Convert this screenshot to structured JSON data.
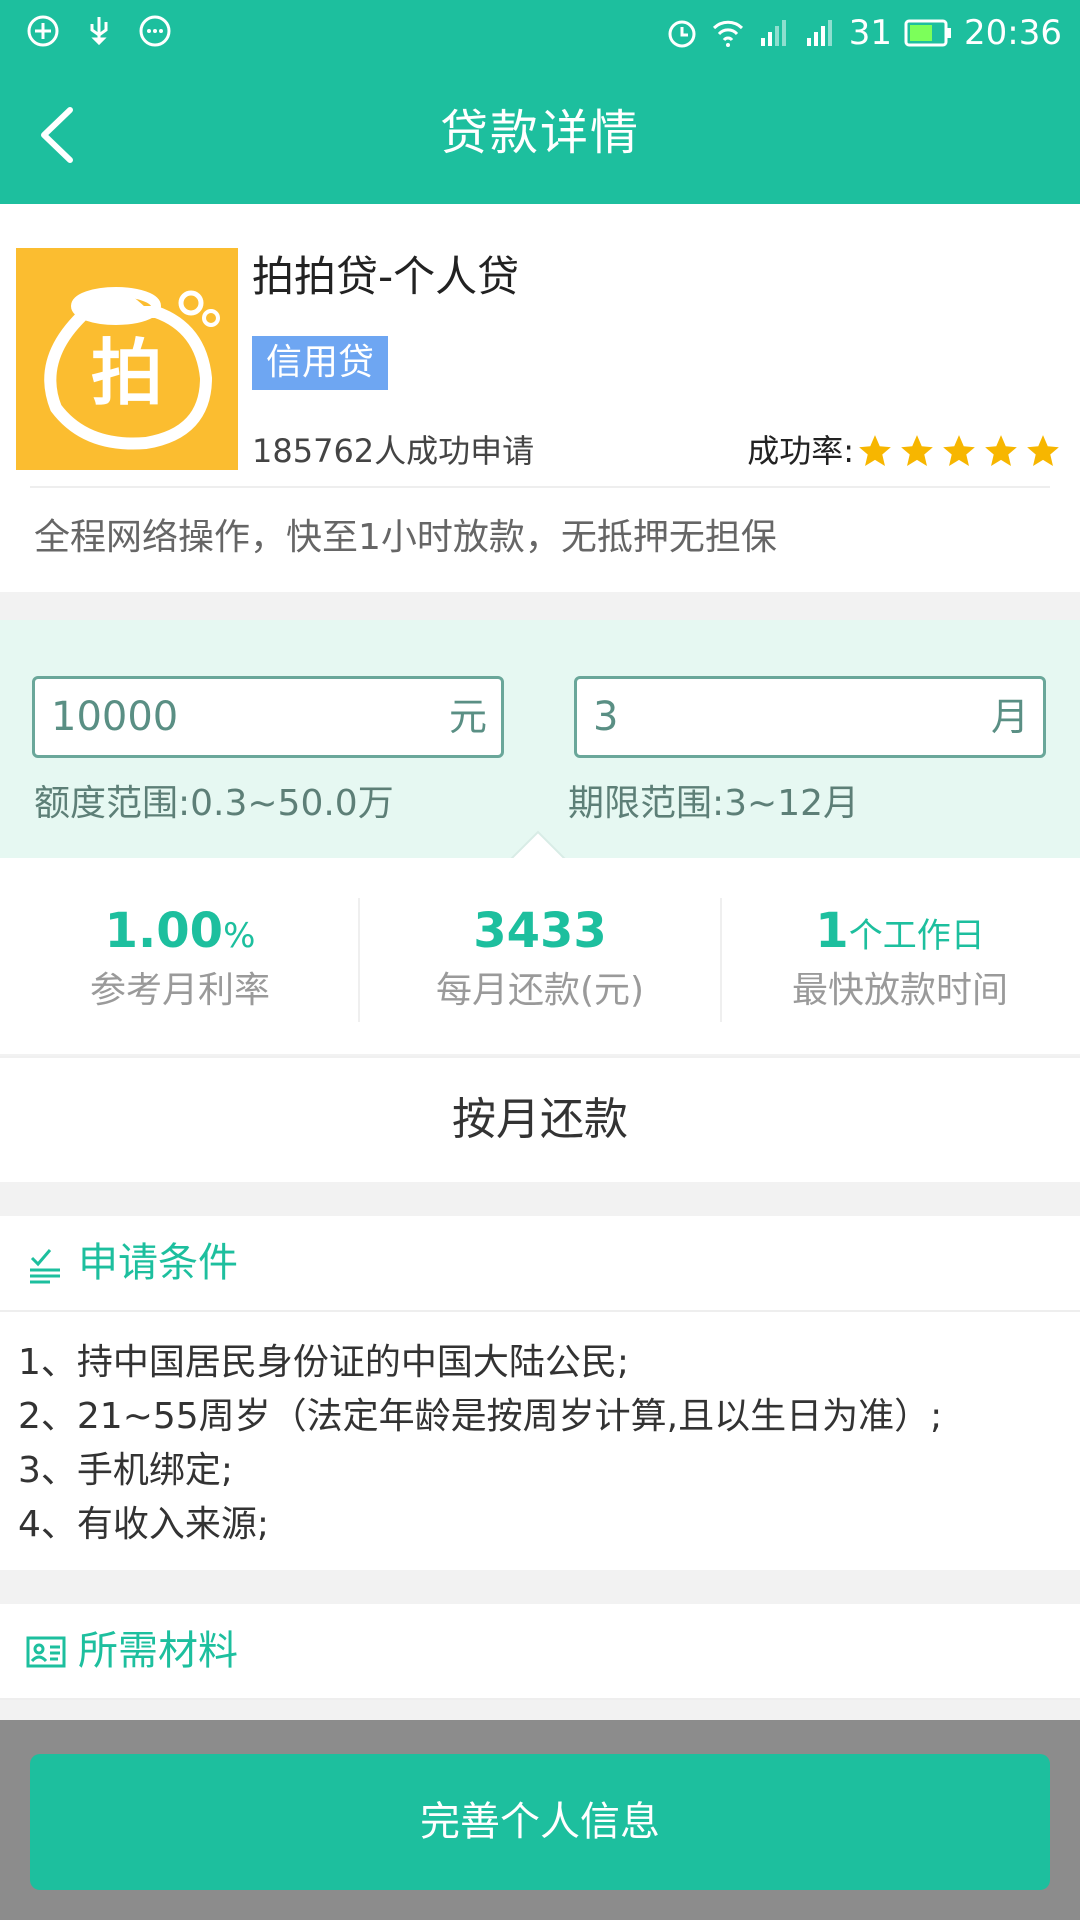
{
  "status_bar": {
    "signal_text": "31",
    "time": "20:36",
    "icons": [
      "vpn-icon",
      "usb-icon",
      "chat-icon",
      "alarm-icon",
      "wifi-icon",
      "signal-icon",
      "signal-icon-2",
      "battery-icon"
    ]
  },
  "toolbar": {
    "title": "贷款详情",
    "back_icon": "back-arrow-icon"
  },
  "product": {
    "name": "拍拍贷-个人贷",
    "tag": "信用贷",
    "apply_count": "185762人成功申请",
    "success_label": "成功率:",
    "success_stars": 5,
    "description": "全程网络操作，快至1小时放款，无抵押无担保",
    "logo_char": "拍"
  },
  "calculator": {
    "amount_value": "10000",
    "amount_unit": "元",
    "amount_range": "额度范围:0.3~50.0万",
    "term_value": "3",
    "term_unit": "月",
    "term_range": "期限范围:3~12月"
  },
  "stats": [
    {
      "value": "1.00",
      "unit": "%",
      "label": "参考月利率"
    },
    {
      "value": "3433",
      "unit": "",
      "label": "每月还款(元)"
    },
    {
      "value": "1",
      "unit": "个工作日",
      "label": "最快放款时间"
    }
  ],
  "repay_method": "按月还款",
  "conditions": {
    "title": "申请条件",
    "items": [
      "1、持中国居民身份证的中国大陆公民;",
      "2、21~55周岁（法定年龄是按周岁计算,且以生日为准）;",
      "3、手机绑定;",
      "4、有收入来源;"
    ]
  },
  "materials": {
    "title": "所需材料"
  },
  "bottom_button": "完善个人信息",
  "colors": {
    "primary": "#1dbf9e",
    "tag": "#6ea6f2",
    "logo_bg": "#fbbd30",
    "star": "#f7b600"
  }
}
